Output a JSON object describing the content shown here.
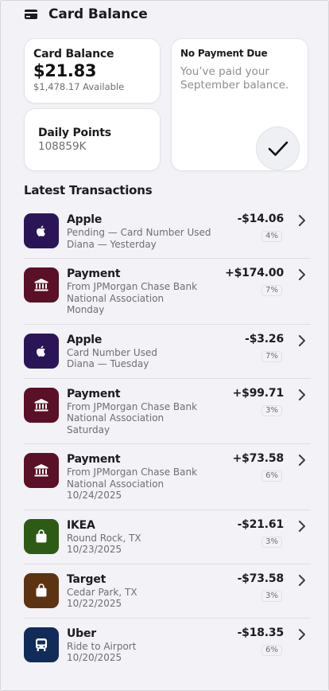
{
  "header": {
    "title": "Card Balance",
    "icon": "credit-card-icon"
  },
  "balance": {
    "label": "Card Balance",
    "amount": "$21.83",
    "available": "$1,478.17 Available"
  },
  "points": {
    "label": "Daily Points",
    "value": "108859K"
  },
  "payment_due": {
    "label": "No Payment Due",
    "message": "You’ve paid your September balance.",
    "icon": "checkmark-icon"
  },
  "transactions_title": "Latest Transactions",
  "transactions": [
    {
      "name": "Apple",
      "line1": "Pending — Card Number Used",
      "line2": "Diana — Yesterday",
      "line3": "",
      "amount": "-$14.06",
      "pct": "4%",
      "icon": "apple-icon",
      "color": "#2a1656"
    },
    {
      "name": "Payment",
      "line1": "From JPMorgan Chase Bank",
      "line2": "National Association",
      "line3": "Monday",
      "amount": "+$174.00",
      "pct": "7%",
      "icon": "bank-icon",
      "color": "#5a1026"
    },
    {
      "name": "Apple",
      "line1": "Card Number Used",
      "line2": "Diana — Tuesday",
      "line3": "",
      "amount": "-$3.26",
      "pct": "7%",
      "icon": "apple-icon",
      "color": "#2a1656"
    },
    {
      "name": "Payment",
      "line1": "From JPMorgan Chase Bank",
      "line2": "National Association",
      "line3": "Saturday",
      "amount": "+$99.71",
      "pct": "3%",
      "icon": "bank-icon",
      "color": "#5a1026"
    },
    {
      "name": "Payment",
      "line1": "From JPMorgan Chase Bank",
      "line2": "National Association",
      "line3": "10/24/2025",
      "amount": "+$73.58",
      "pct": "6%",
      "icon": "bank-icon",
      "color": "#5a1026"
    },
    {
      "name": "IKEA",
      "line1": "Round Rock, TX",
      "line2": "10/23/2025",
      "line3": "",
      "amount": "-$21.61",
      "pct": "3%",
      "icon": "shopping-bag-icon",
      "color": "#2d5a14"
    },
    {
      "name": "Target",
      "line1": "Cedar Park, TX",
      "line2": "10/22/2025",
      "line3": "",
      "amount": "-$73.58",
      "pct": "3%",
      "icon": "shopping-bag-icon",
      "color": "#5c3412"
    },
    {
      "name": "Uber",
      "line1": "Ride to Airport",
      "line2": "10/20/2025",
      "line3": "",
      "amount": "-$18.35",
      "pct": "6%",
      "icon": "bus-icon",
      "color": "#122c5a"
    }
  ]
}
